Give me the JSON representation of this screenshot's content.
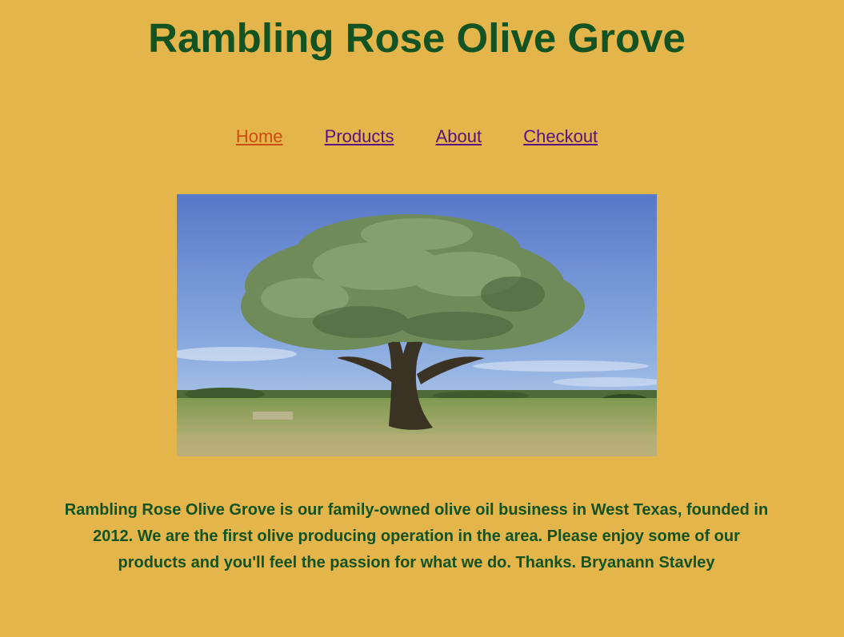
{
  "header": {
    "title": "Rambling Rose Olive Grove"
  },
  "nav": {
    "items": [
      {
        "label": "Home"
      },
      {
        "label": "Products"
      },
      {
        "label": "About"
      },
      {
        "label": "Checkout"
      }
    ]
  },
  "hero": {
    "alt": "Olive tree in a grassy field under a blue sky"
  },
  "intro": {
    "text": "Rambling Rose Olive Grove is our family-owned olive oil business in West Texas, founded in 2012. We are the first olive producing operation in the area. Please enjoy some of our products and you'll feel the passion for what we do. Thanks. Bryanann Stavley"
  },
  "colors": {
    "background": "#e3b54a",
    "title": "#135323",
    "link_current": "#cc4d10",
    "link_visited": "#5a1280"
  }
}
